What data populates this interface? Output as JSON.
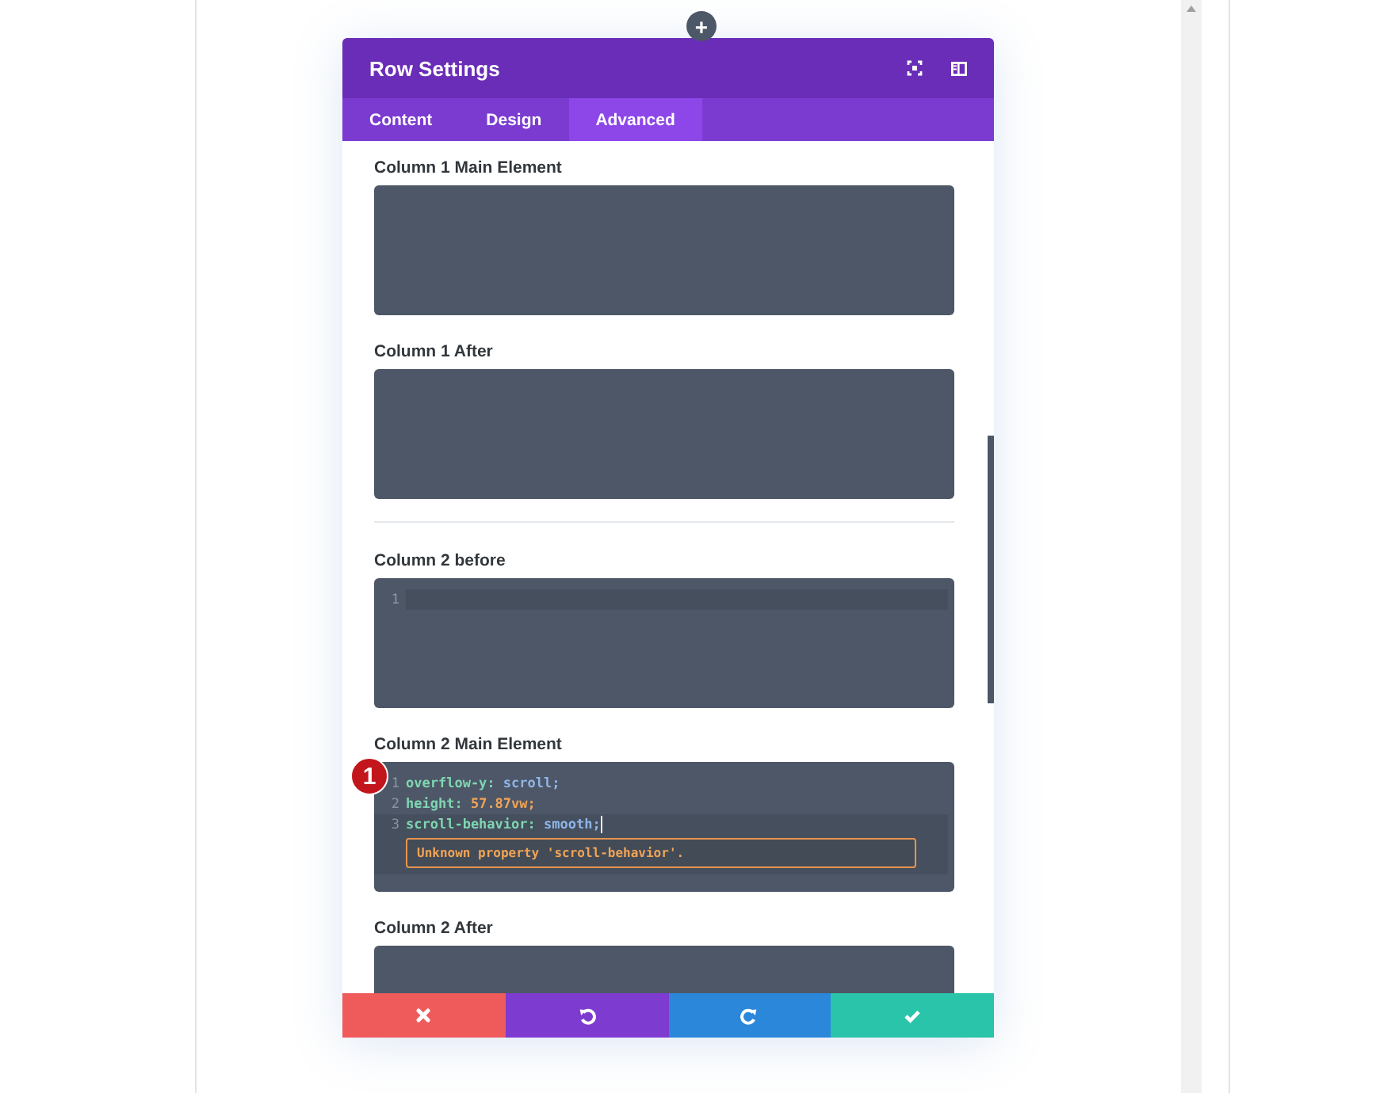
{
  "add_button": {
    "label": "+"
  },
  "window": {
    "title": "Row Settings"
  },
  "tabs": [
    {
      "label": "Content",
      "selected": false
    },
    {
      "label": "Design",
      "selected": false
    },
    {
      "label": "Advanced",
      "selected": true
    }
  ],
  "fields": [
    {
      "label": "Column 1 Main Element",
      "kind": "empty"
    },
    {
      "label": "Column 1 After",
      "kind": "empty"
    },
    {
      "kind": "divider"
    },
    {
      "label": "Column 2 before",
      "kind": "code",
      "lines": [
        {
          "number": "1",
          "active": true
        }
      ]
    },
    {
      "label": "Column 2 Main Element",
      "kind": "code",
      "badge": "1",
      "lines": [
        {
          "number": "1",
          "active": false,
          "property": "overflow-y:",
          "value": "scroll;",
          "kind": "keyword"
        },
        {
          "number": "2",
          "active": false,
          "property": "height:",
          "value": "57.87vw;",
          "kind": "number"
        },
        {
          "number": "3",
          "active": true,
          "property": "scroll-behavior:",
          "value": "smooth;",
          "kind": "keyword",
          "error": "Unknown property 'scroll-behavior'."
        }
      ]
    },
    {
      "label": "Column 2 After",
      "kind": "empty"
    }
  ],
  "footer_buttons": [
    {
      "kind": "discard",
      "color": "#ef5b5b"
    },
    {
      "kind": "undo",
      "color": "#7e3bd0"
    },
    {
      "kind": "redo",
      "color": "#2b87da"
    },
    {
      "kind": "save",
      "color": "#29c4a9"
    }
  ]
}
